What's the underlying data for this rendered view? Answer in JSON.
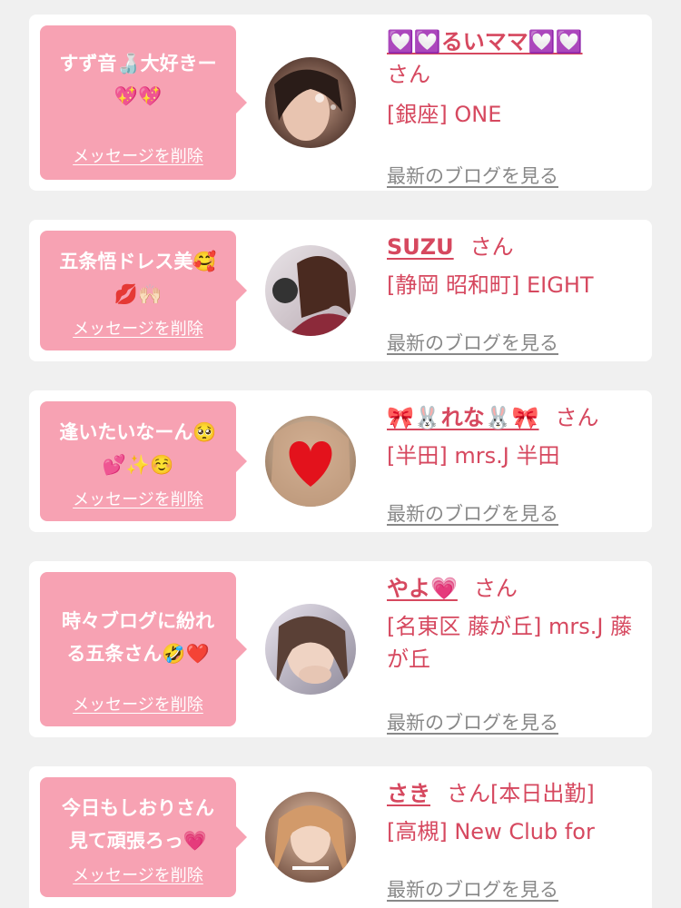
{
  "colors": {
    "background": "#f0f0f0",
    "card": "#ffffff",
    "bubble": "#f7a2b3",
    "name": "#d6485f",
    "link": "#888888"
  },
  "messages": [
    {
      "text": "すず音🍶大好きー\n💖💖",
      "delete_label": "メッセージを削除",
      "name": "💟💟るいママ💟💟",
      "san": "さん",
      "shop": "[銀座] ONE",
      "blog_label": "最新のブログを見る"
    },
    {
      "text": "五条悟ドレス美🥰\n💋🙌🏻",
      "delete_label": "メッセージを削除",
      "name": "SUZU",
      "san": "さん",
      "shop": "[静岡 昭和町] EIGHT",
      "blog_label": "最新のブログを見る"
    },
    {
      "text": "逢いたいなーん🥺\n💕✨☺️",
      "delete_label": "メッセージを削除",
      "name": "🎀🐰れな🐰🎀",
      "san": "さん",
      "shop": "[半田] mrs.J 半田",
      "blog_label": "最新のブログを見る"
    },
    {
      "text": "時々ブログに紛れ\nる五条さん🤣❤️",
      "delete_label": "メッセージを削除",
      "name": "やよ💗",
      "san": "さん",
      "shop": "[名東区 藤が丘] mrs.J 藤が丘",
      "blog_label": "最新のブログを見る"
    },
    {
      "text": "今日もしおりさん\n見て頑張ろっ💗",
      "delete_label": "メッセージを削除",
      "name": "さき",
      "san": "さん[本日出勤]",
      "shop": "[高槻] New Club for",
      "blog_label": "最新のブログを見る"
    }
  ]
}
